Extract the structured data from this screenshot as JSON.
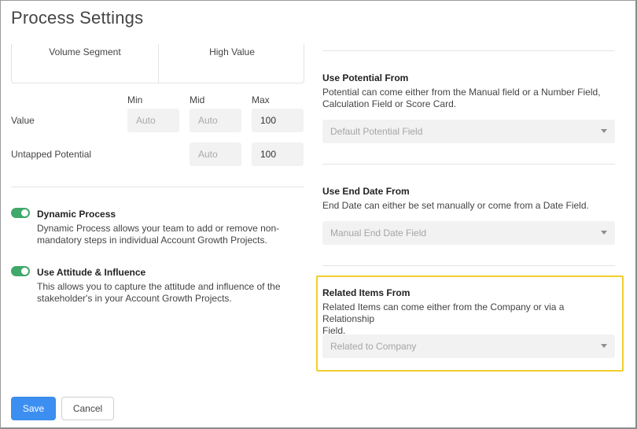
{
  "page": {
    "title": "Process Settings"
  },
  "segment": {
    "volume_label": "Volume Segment",
    "high_label": "High Value"
  },
  "columns": {
    "min": "Min",
    "mid": "Mid",
    "max": "Max"
  },
  "rows": {
    "value": {
      "label": "Value",
      "min_placeholder": "Auto",
      "mid_placeholder": "Auto",
      "max_value": "100"
    },
    "untapped": {
      "label": "Untapped Potential",
      "mid_placeholder": "Auto",
      "max_value": "100"
    }
  },
  "options": {
    "dynamic": {
      "enabled": true,
      "title": "Dynamic Process",
      "desc_line1": "Dynamic Process allows your team to add or remove non-",
      "desc_line2": "mandatory steps in individual Account Growth Projects."
    },
    "attitude": {
      "enabled": true,
      "title": "Use Attitude & Influence",
      "desc_line1": "This allows you to capture the attitude and influence of the",
      "desc_line2": "stakeholder's in your Account Growth Projects."
    }
  },
  "potential": {
    "title": "Use Potential From",
    "desc_line1": "Potential can come either from the Manual field or a Number Field,",
    "desc_line2": "Calculation Field or Score Card.",
    "selected": "Default Potential Field"
  },
  "end_date": {
    "title": "Use End Date From",
    "desc_line1": "End Date can either be set manually or come from a Date Field.",
    "selected": "Manual End Date Field"
  },
  "related": {
    "title": "Related Items From",
    "desc_line1": "Related Items can come either from the Company or via a Relationship",
    "desc_line2": "Field.",
    "selected": "Related to Company"
  },
  "footer": {
    "save_label": "Save",
    "cancel_label": "Cancel"
  },
  "colors": {
    "toggle_on": "#3fa86a",
    "primary_button": "#3c8ff1",
    "highlight_border": "#f2cd2b"
  }
}
